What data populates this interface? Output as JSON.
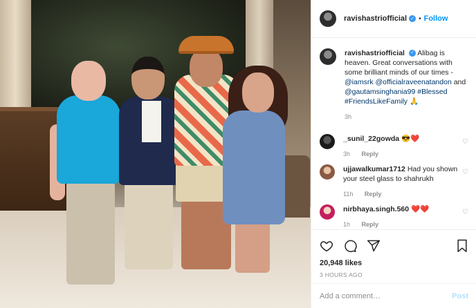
{
  "post": {
    "username": "ravishastriofficial",
    "verified_symbol": "✓",
    "separator": "•",
    "follow_label": "Follow"
  },
  "caption": {
    "username": "ravishastriofficial",
    "text_1": "Alibag is heaven. Great conversations with some brilliant minds of our times - ",
    "mention_1": "@iamsrk",
    "mention_2": "@officialraveenatandon",
    "text_and": " and ",
    "mention_3": "@gautamsinghania99",
    "hashtag_1": "#Blessed",
    "hashtag_2": "#FriendsLikeFamily",
    "emoji": "🙏",
    "time": "3h"
  },
  "comments": [
    {
      "username": "_sunil_22gowda",
      "text": "😎❤️",
      "time": "3h",
      "reply_label": "Reply"
    },
    {
      "username": "ujjawalkumar1712",
      "text": "Had you shown your steel glass to shahrukh",
      "time": "11h",
      "reply_label": "Reply"
    },
    {
      "username": "nirbhaya.singh.560",
      "text": "❤️❤️",
      "time": "1h",
      "reply_label": "Reply"
    }
  ],
  "stats": {
    "likes": "20,948 likes",
    "posted": "3 HOURS AGO"
  },
  "composer": {
    "placeholder": "Add a comment…",
    "post_label": "Post"
  },
  "colors": {
    "accent": "#0095f6",
    "verified": "#3897f0",
    "muted": "#8e8e8e",
    "post_disabled": "#b2dffc"
  },
  "icons": {
    "like": "heart-icon",
    "comment": "comment-icon",
    "share": "send-icon",
    "save": "bookmark-icon"
  }
}
